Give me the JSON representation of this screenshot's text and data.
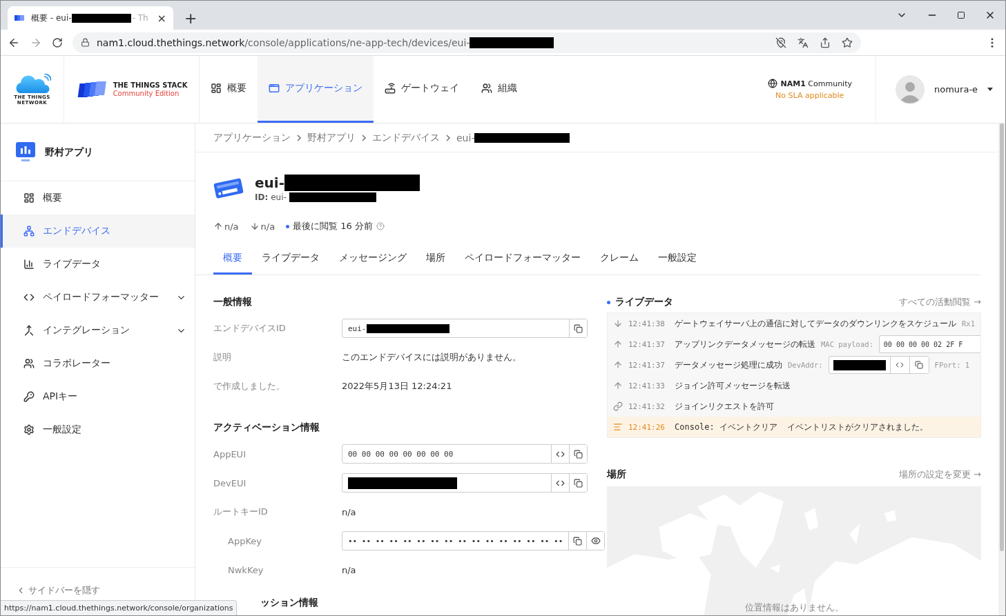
{
  "browser": {
    "tab_title": "概要 - eui-",
    "tab_title_tail": "- Th",
    "tab_close": "×",
    "new_tab": "+",
    "url_host": "nam1.cloud.thethings.network",
    "url_path": "/console/applications/ne-app-tech/devices/eui-",
    "url_redacted": true
  },
  "header": {
    "ttn_logo": [
      "THE THINGS",
      "NETWORK"
    ],
    "stack_name": "THE THINGS STACK",
    "stack_edition": "Community Edition",
    "nav": [
      {
        "label": "概要",
        "selected": false
      },
      {
        "label": "アプリケーション",
        "selected": true
      },
      {
        "label": "ゲートウェイ",
        "selected": false
      },
      {
        "label": "組織",
        "selected": false
      }
    ],
    "cluster": {
      "name": "NAM1",
      "tier": "Community",
      "sla": "No SLA applicable"
    },
    "user": "nomura-e"
  },
  "sidebar": {
    "title": "野村アプリ",
    "items": [
      {
        "label": "概要",
        "selected": false,
        "expandable": false
      },
      {
        "label": "エンドデバイス",
        "selected": true,
        "expandable": false
      },
      {
        "label": "ライブデータ",
        "selected": false,
        "expandable": false
      },
      {
        "label": "ペイロードフォーマッター",
        "selected": false,
        "expandable": true
      },
      {
        "label": "インテグレーション",
        "selected": false,
        "expandable": true
      },
      {
        "label": "コラボレーター",
        "selected": false,
        "expandable": false
      },
      {
        "label": "APIキー",
        "selected": false,
        "expandable": false
      },
      {
        "label": "一般設定",
        "selected": false,
        "expandable": false
      }
    ],
    "hide": "サイドバーを隠す"
  },
  "breadcrumbs": [
    {
      "label": "アプリケーション",
      "redacted": false
    },
    {
      "label": "野村アプリ",
      "redacted": false
    },
    {
      "label": "エンドデバイス",
      "redacted": false
    },
    {
      "label": "eui-",
      "redacted": true
    }
  ],
  "device": {
    "name": "eui-",
    "id_label": "ID:",
    "id": "eui-",
    "uplink": "n/a",
    "downlink": "n/a",
    "last_seen": "最後に閲覧 16 分前"
  },
  "tabs": [
    {
      "label": "概要",
      "selected": true
    },
    {
      "label": "ライブデータ",
      "selected": false
    },
    {
      "label": "メッセージング",
      "selected": false
    },
    {
      "label": "場所",
      "selected": false
    },
    {
      "label": "ペイロードフォーマッター",
      "selected": false
    },
    {
      "label": "クレーム",
      "selected": false
    },
    {
      "label": "一般設定",
      "selected": false
    }
  ],
  "general": {
    "title": "一般情報",
    "rows": [
      {
        "kind": "id-field",
        "label": "エンドデバイスID",
        "value": "eui-",
        "redacted": true,
        "indent": false
      },
      {
        "kind": "text",
        "label": "説明",
        "value": "このエンドデバイスには説明がありません。",
        "indent": false
      },
      {
        "kind": "text",
        "label": "で作成しました。",
        "value": "2022年5月13日 12:24:21",
        "indent": false
      }
    ]
  },
  "activation": {
    "title": "アクティベーション情報",
    "rows": [
      {
        "kind": "eui-field",
        "label": "AppEUI",
        "value": "00 00 00 00 00 00 00 00",
        "redacted": false,
        "indent": false
      },
      {
        "kind": "eui-field",
        "label": "DevEUI",
        "redacted": true,
        "indent": false
      },
      {
        "kind": "text",
        "label": "ルートキーID",
        "value": "n/a",
        "indent": false
      },
      {
        "kind": "secret-field",
        "label": "AppKey",
        "value": "•• •• •• •• •• •• •• •• •• •• •• •• •• •• •• ••",
        "redacted": false,
        "indent": true
      },
      {
        "kind": "text",
        "label": "NwkKey",
        "value": "n/a",
        "indent": true
      }
    ]
  },
  "session": {
    "title": "ッション情報"
  },
  "live": {
    "title": "ライブデータ",
    "link": "すべての活動閲覧 →",
    "events": [
      {
        "kind": "downlink",
        "time": "12:41:38",
        "message": "ゲートウェイサーバ上の通信に対してデータのダウンリンクをスケジュール",
        "details": [
          {
            "kind": "label",
            "text": "Rx1"
          }
        ]
      },
      {
        "kind": "uplink",
        "time": "12:41:37",
        "message": "アップリンクデータメッセージの転送",
        "details": [
          {
            "kind": "label",
            "text": "MAC payload:"
          },
          {
            "kind": "value",
            "text": "00 00 00 00 02 2F F"
          }
        ]
      },
      {
        "kind": "uplink",
        "time": "12:41:37",
        "message": "データメッセージ処理に成功",
        "details": [
          {
            "kind": "label",
            "text": "DevAddr:"
          },
          {
            "kind": "redacted-field"
          },
          {
            "kind": "label",
            "text": "FPort: 1"
          }
        ]
      },
      {
        "kind": "uplink",
        "time": "12:41:33",
        "message": "ジョイン許可メッセージを転送"
      },
      {
        "kind": "join",
        "time": "12:41:32",
        "message": "ジョインリクエストを許可"
      },
      {
        "kind": "console",
        "time": "12:41:26",
        "message": "Console: イベントクリア",
        "details": [
          {
            "kind": "text",
            "text": "イベントリストがクリアされました。"
          }
        ]
      }
    ]
  },
  "location": {
    "title": "場所",
    "link": "場所の設定を変更 →",
    "empty": "位置情報はありません。"
  },
  "status_url": "https://nam1.cloud.thethings.network/console/organizations"
}
